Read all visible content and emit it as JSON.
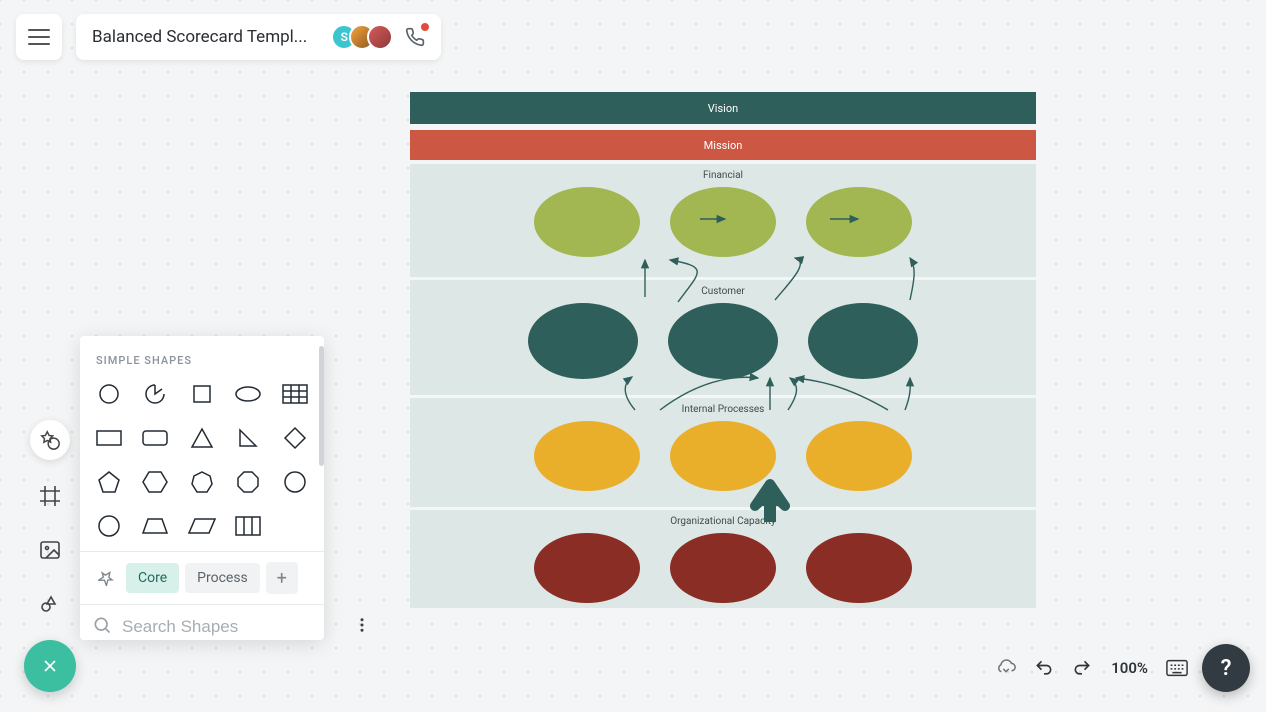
{
  "title": "Balanced Scorecard Templ...",
  "participants": {
    "p1_initial": "S"
  },
  "shapes_panel": {
    "header": "SIMPLE SHAPES",
    "tabs": {
      "core": "Core",
      "process": "Process"
    },
    "search_placeholder": "Search Shapes"
  },
  "diagram": {
    "vision": "Vision",
    "mission": "Mission",
    "financial": "Financial",
    "customer": "Customer",
    "internal": "Internal Processes",
    "organizational": "Organizational Capacity"
  },
  "zoom": "100%",
  "help": "?",
  "colors": {
    "vision": "#2f5f5a",
    "mission": "#cc5743",
    "section": "#dde7e6",
    "oval_green": "#a2b751",
    "oval_teal": "#2f5f5a",
    "oval_gold": "#e9af2b",
    "oval_red": "#8a2d24",
    "accent": "#3bbfa0"
  }
}
